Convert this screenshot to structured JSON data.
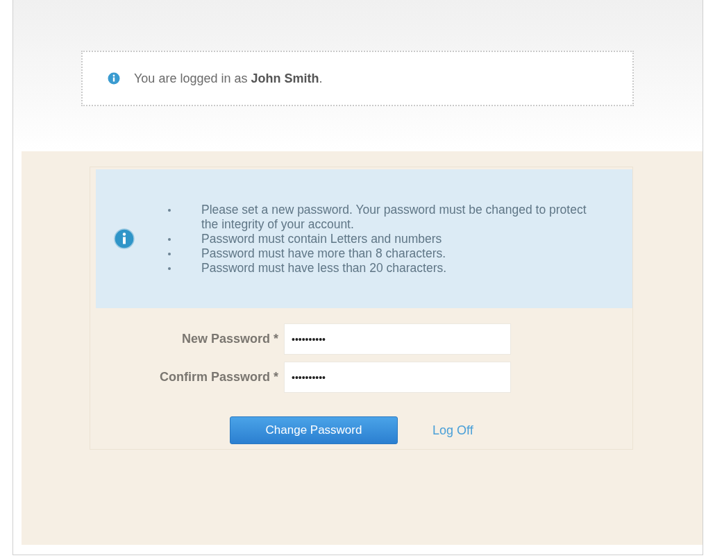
{
  "login_notice": {
    "text": "You are logged in as **John Smith**."
  },
  "requirements": [
    "Please set a new password. Your password must be changed to protect the integrity of your account.",
    "Password must contain Letters and numbers",
    "Password must have more than 8 characters.",
    "Password must have less than 20 characters."
  ],
  "fields": [
    {
      "label": "New Password *",
      "value": "••••••••••"
    },
    {
      "label": "Confirm Password *",
      "value": "••••••••••"
    }
  ],
  "submit_button": "Change Password",
  "logoff_link": "Log Off"
}
